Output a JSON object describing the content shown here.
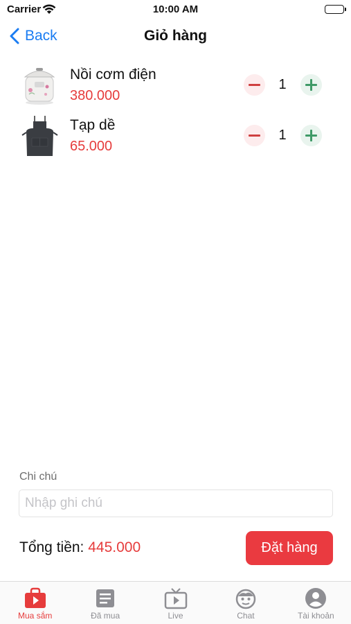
{
  "status_bar": {
    "carrier": "Carrier",
    "time": "10:00 AM"
  },
  "nav": {
    "back_label": "Back",
    "title": "Giỏ hàng"
  },
  "cart": {
    "items": [
      {
        "name": "Nồi cơm điện",
        "price": "380.000",
        "quantity": "1",
        "image": "rice-cooker"
      },
      {
        "name": "Tạp dề",
        "price": "65.000",
        "quantity": "1",
        "image": "apron"
      }
    ]
  },
  "note": {
    "label": "Chi chú",
    "placeholder": "Nhập ghi chú",
    "value": ""
  },
  "summary": {
    "total_label": "Tổng tiền:",
    "total_value": "445.000",
    "order_button": "Đặt hàng"
  },
  "tab_bar": {
    "items": [
      {
        "label": "Mua sắm",
        "icon": "shopping-bag-play-icon",
        "active": true
      },
      {
        "label": "Đã mua",
        "icon": "purchased-list-icon",
        "active": false
      },
      {
        "label": "Live",
        "icon": "tv-live-icon",
        "active": false
      },
      {
        "label": "Chat",
        "icon": "chat-face-icon",
        "active": false
      },
      {
        "label": "Tài khoản",
        "icon": "account-person-icon",
        "active": false
      }
    ]
  },
  "colors": {
    "accent": "#e63c3c",
    "link": "#1a7cf2",
    "order_button": "#ea3a40",
    "minus": "#cf4040",
    "plus": "#3f9a67",
    "tab_inactive": "#8e8e93"
  }
}
